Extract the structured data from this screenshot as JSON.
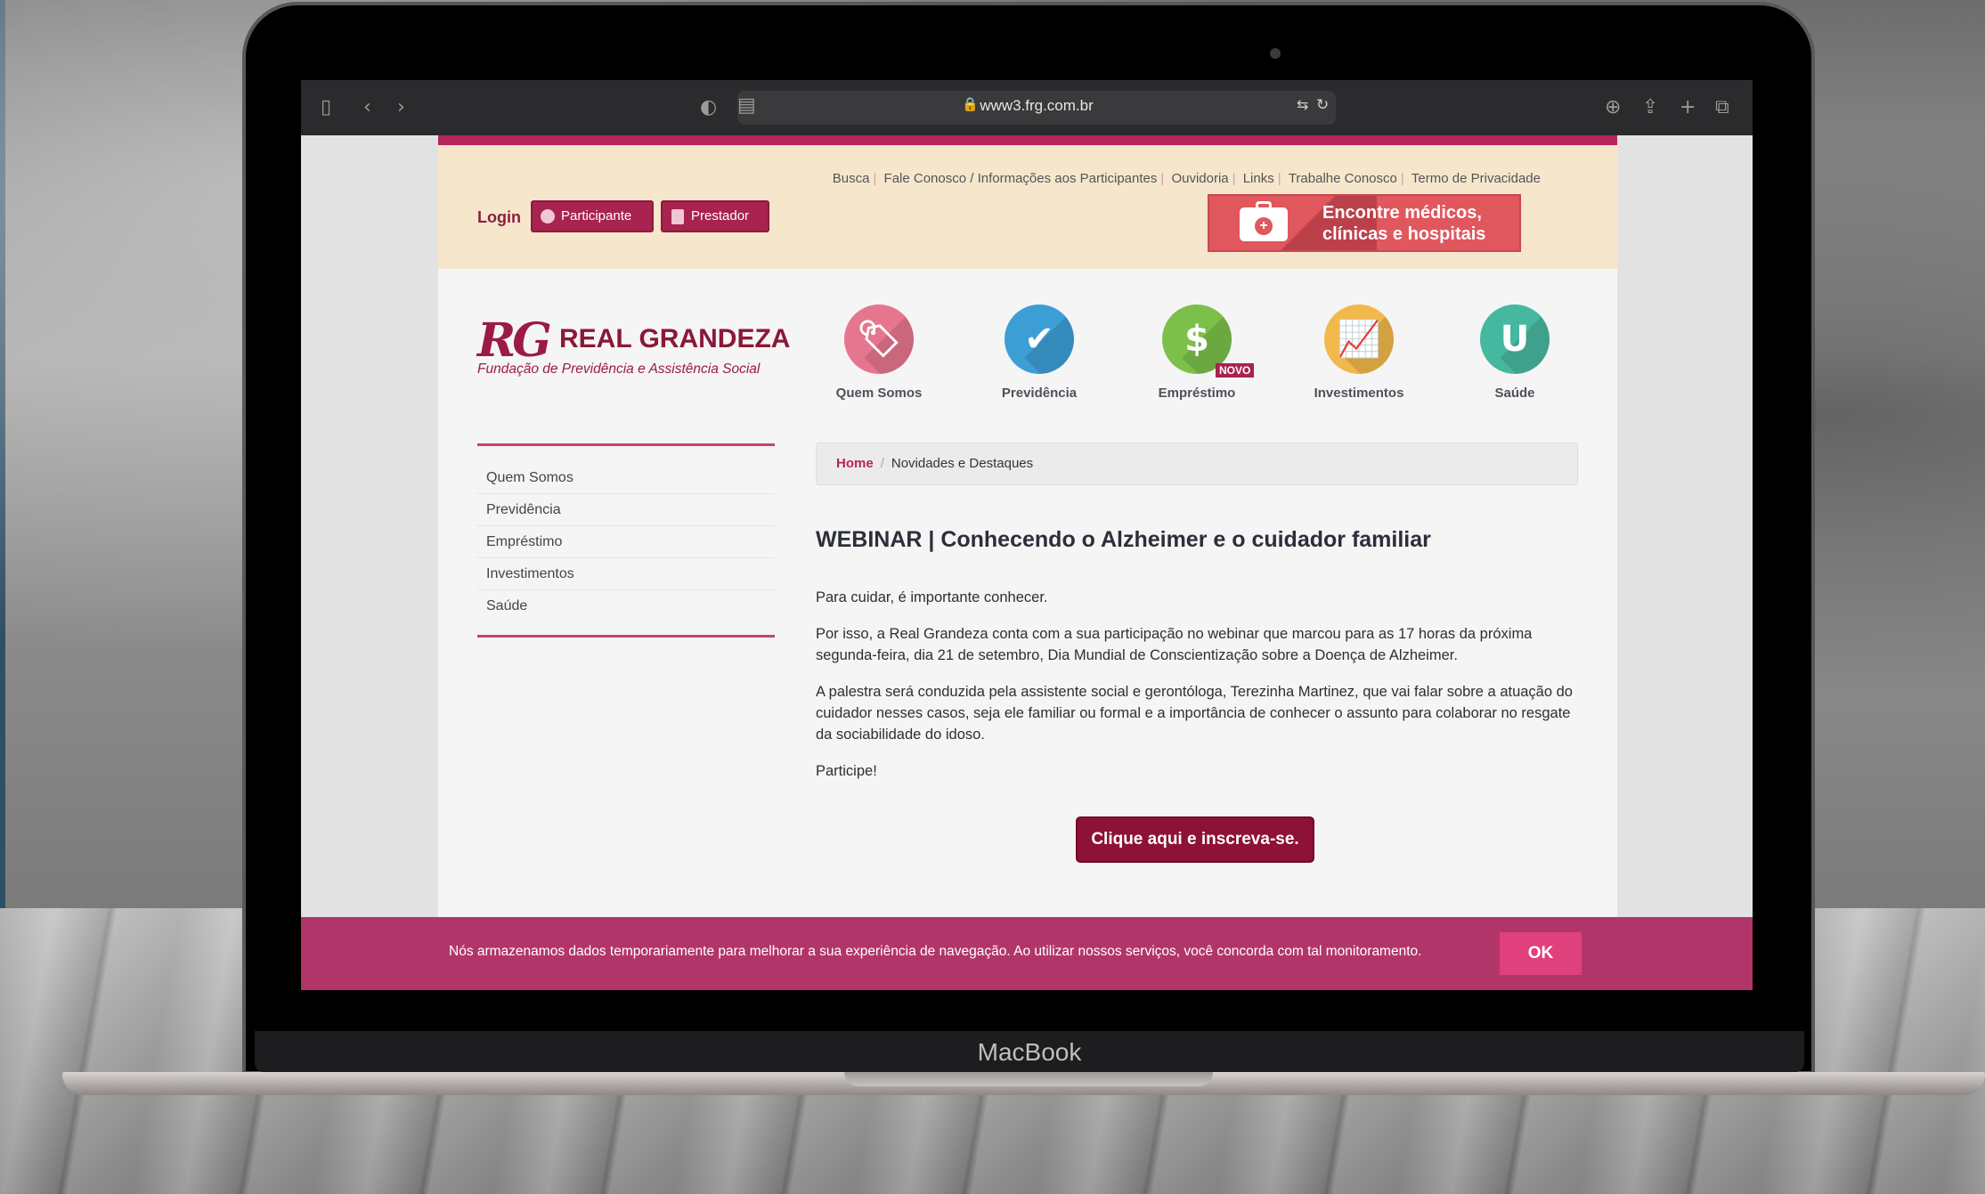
{
  "device": {
    "brand_label": "MacBook"
  },
  "browser": {
    "url": "www3.frg.com.br",
    "icons": [
      "sidebar-icon",
      "back-icon",
      "forward-icon",
      "shield-icon",
      "reader-icon",
      "lock-icon",
      "translate-icon",
      "reload-icon",
      "download-icon",
      "share-icon",
      "plus-icon",
      "tabs-icon"
    ]
  },
  "topbar": {
    "links": [
      "Busca",
      "Fale Conosco / Informações aos Participantes",
      "Ouvidoria",
      "Links",
      "Trabalhe Conosco",
      "Termo de Privacidade"
    ],
    "login_label": "Login",
    "participante_label": "Participante",
    "prestador_label": "Prestador",
    "doctor_line1": "Encontre médicos,",
    "doctor_line2": "clínicas e hospitais"
  },
  "logo": {
    "mark": "RG",
    "name": "REAL GRANDEZA",
    "subtitle": "Fundação de Previdência e Assistência Social"
  },
  "nav": [
    {
      "label": "Quem Somos",
      "icon": "tag-icon",
      "glyph": "🏷",
      "color": "#e6768f"
    },
    {
      "label": "Previdência",
      "icon": "clipboard-icon",
      "glyph": "✔",
      "color": "#3d9ed6"
    },
    {
      "label": "Empréstimo",
      "icon": "dollar-icon",
      "glyph": "$",
      "color": "#7cc04a",
      "badge": "NOVO"
    },
    {
      "label": "Investimentos",
      "icon": "chart-icon",
      "glyph": "📈",
      "color": "#f2b84b"
    },
    {
      "label": "Saúde",
      "icon": "stethoscope-icon",
      "glyph": "U",
      "color": "#47b8a0"
    }
  ],
  "sidebar": [
    "Quem Somos",
    "Previdência",
    "Empréstimo",
    "Investimentos",
    "Saúde"
  ],
  "breadcrumb": {
    "home": "Home",
    "current": "Novidades e Destaques"
  },
  "article": {
    "title": "WEBINAR | Conhecendo o Alzheimer e o cuidador familiar",
    "p1": "Para cuidar, é importante conhecer.",
    "p2": "Por isso, a Real Grandeza conta com a sua participação no webinar que marcou para as 17 horas da próxima segunda-feira, dia 21 de setembro, Dia Mundial de Conscientização sobre a Doença de Alzheimer.",
    "p3": "A palestra será conduzida pela assistente social e gerontóloga, Terezinha Martinez, que vai falar sobre a atuação do cuidador nesses casos, seja ele familiar ou formal e a importância de conhecer o assunto para colaborar no resgate da sociabilidade do idoso.",
    "p4": "Participe!",
    "cta": "Clique aqui e inscreva-se."
  },
  "cookie": {
    "text": "Nós armazenamos dados temporariamente para melhorar a sua experiência de navegação. Ao utilizar nossos serviços, você concorda com tal monitoramento.",
    "ok": "OK"
  }
}
